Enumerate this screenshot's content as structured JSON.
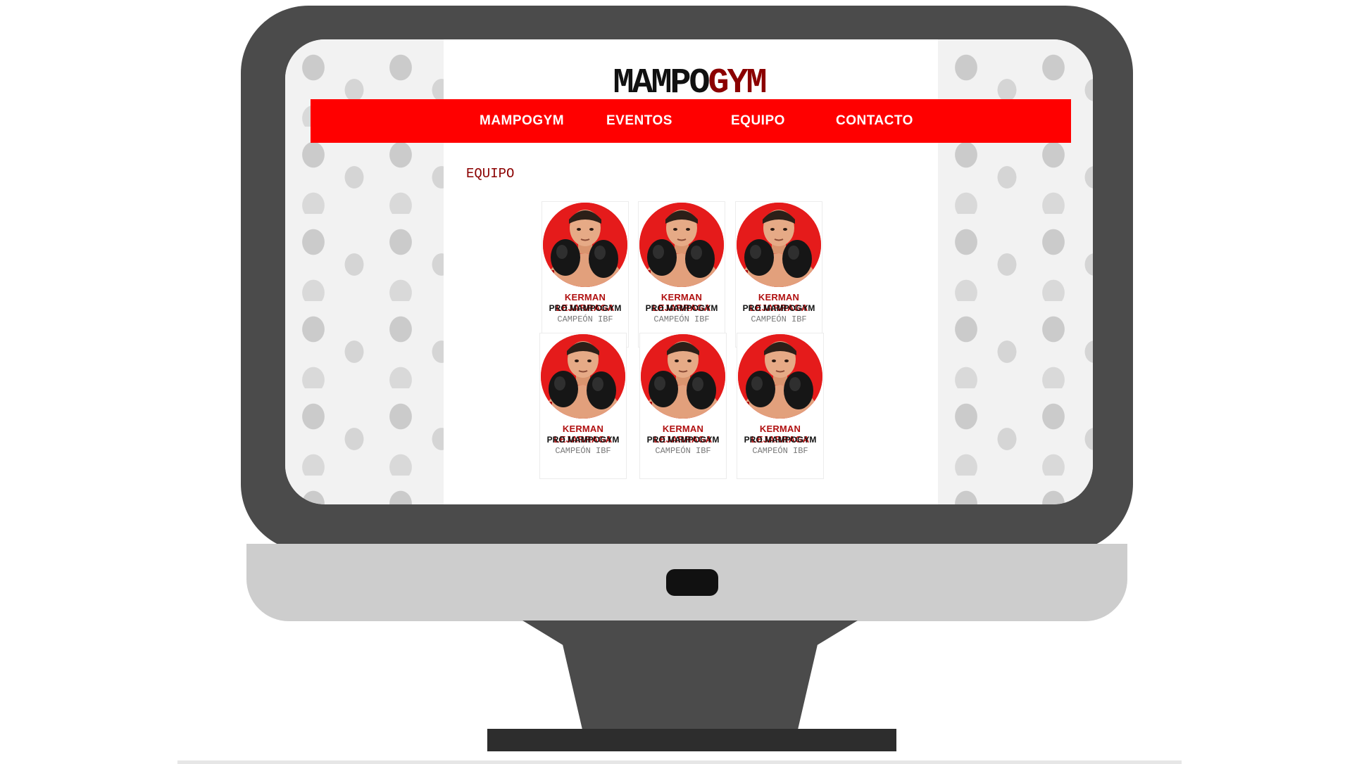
{
  "site": {
    "logo_main": "MAMPO",
    "logo_accent": "GYM"
  },
  "nav": {
    "items": [
      {
        "label": "MAMPOGYM"
      },
      {
        "label": "EVENTOS"
      },
      {
        "label": "EQUIPO"
      },
      {
        "label": "CONTACTO"
      }
    ]
  },
  "section": {
    "title": "EQUIPO"
  },
  "team": [
    {
      "name": "KERMAN LEJARRAGA",
      "role": "PRO MAMPOGYM",
      "title": "CAMPEÓN IBF"
    },
    {
      "name": "KERMAN LEJARRAGA",
      "role": "PRO MAMPOGYM",
      "title": "CAMPEÓN IBF"
    },
    {
      "name": "KERMAN LEJARRAGA",
      "role": "PRO MAMPOGYM",
      "title": "CAMPEÓN IBF"
    },
    {
      "name": "KERMAN LEJARRAGA",
      "role": "PRO MAMPOGYM",
      "title": "CAMPEÓN IBF"
    },
    {
      "name": "KERMAN LEJARRAGA",
      "role": "PRO MAMPOGYM",
      "title": "CAMPEÓN IBF"
    },
    {
      "name": "KERMAN LEJARRAGA",
      "role": "PRO MAMPOGYM",
      "title": "CAMPEÓN IBF"
    }
  ],
  "colors": {
    "nav_background": "#ff0000",
    "accent": "#8b0000",
    "monitor_frame": "#4b4b4b",
    "monitor_chin": "#cdcdcd"
  },
  "icons": {
    "background_pattern": "boxing-glove-icon",
    "avatar": "boxer-photo"
  }
}
